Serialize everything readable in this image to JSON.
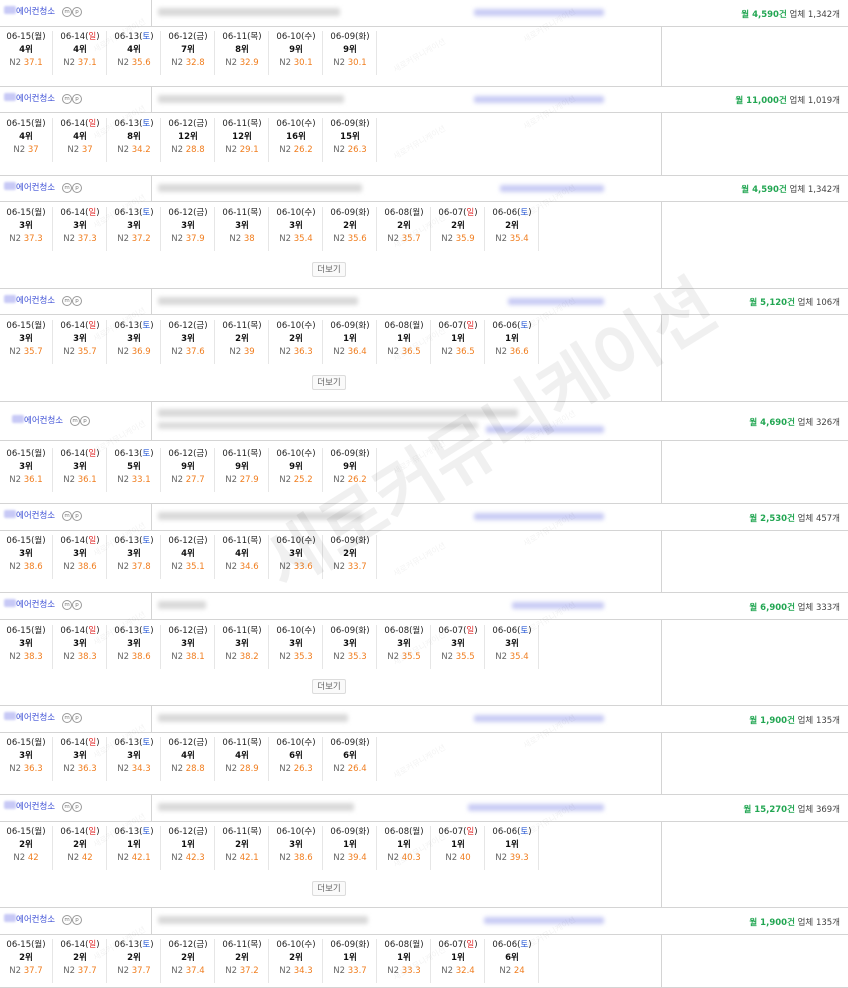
{
  "watermark": "새로커뮤니케이션",
  "more_label": "더보기",
  "monthly_unit": "건",
  "biz_unit": "개",
  "rows": [
    {
      "keyword": "에어컨청소",
      "monthly": "월 4,590건",
      "biz": "업체 1,342개",
      "more": false,
      "dates": [
        {
          "d": "06-15",
          "w": "월"
        },
        {
          "d": "06-14",
          "w": "일"
        },
        {
          "d": "06-13",
          "w": "토"
        },
        {
          "d": "06-12",
          "w": "금"
        },
        {
          "d": "06-11",
          "w": "목"
        },
        {
          "d": "06-10",
          "w": "수"
        },
        {
          "d": "06-09",
          "w": "화"
        }
      ],
      "ranks": [
        "4위",
        "4위",
        "4위",
        "7위",
        "8위",
        "9위",
        "9위"
      ],
      "n2": [
        "37.1",
        "37.1",
        "35.6",
        "32.8",
        "32.9",
        "30.1",
        "30.1"
      ]
    },
    {
      "keyword": "에어컨청소",
      "monthly": "월 11,000건",
      "biz": "업체 1,019개",
      "more": false,
      "dates": [
        {
          "d": "06-15",
          "w": "월"
        },
        {
          "d": "06-14",
          "w": "일"
        },
        {
          "d": "06-13",
          "w": "토"
        },
        {
          "d": "06-12",
          "w": "금"
        },
        {
          "d": "06-11",
          "w": "목"
        },
        {
          "d": "06-10",
          "w": "수"
        },
        {
          "d": "06-09",
          "w": "화"
        }
      ],
      "ranks": [
        "4위",
        "4위",
        "8위",
        "12위",
        "12위",
        "16위",
        "15위"
      ],
      "n2": [
        "37",
        "37",
        "34.2",
        "28.8",
        "29.1",
        "26.2",
        "26.3"
      ]
    },
    {
      "keyword": "에어컨청소",
      "monthly": "월 4,590건",
      "biz": "업체 1,342개",
      "more": true,
      "dates": [
        {
          "d": "06-15",
          "w": "월"
        },
        {
          "d": "06-14",
          "w": "일"
        },
        {
          "d": "06-13",
          "w": "토"
        },
        {
          "d": "06-12",
          "w": "금"
        },
        {
          "d": "06-11",
          "w": "목"
        },
        {
          "d": "06-10",
          "w": "수"
        },
        {
          "d": "06-09",
          "w": "화"
        },
        {
          "d": "06-08",
          "w": "월"
        },
        {
          "d": "06-07",
          "w": "일"
        },
        {
          "d": "06-06",
          "w": "토"
        }
      ],
      "ranks": [
        "3위",
        "3위",
        "3위",
        "3위",
        "3위",
        "3위",
        "2위",
        "2위",
        "2위",
        "2위"
      ],
      "n2": [
        "37.3",
        "37.3",
        "37.2",
        "37.9",
        "38",
        "35.4",
        "35.6",
        "35.7",
        "35.9",
        "35.4"
      ]
    },
    {
      "keyword": "에어컨청소",
      "monthly": "월 5,120건",
      "biz": "업체 106개",
      "more": true,
      "dates": [
        {
          "d": "06-15",
          "w": "월"
        },
        {
          "d": "06-14",
          "w": "일"
        },
        {
          "d": "06-13",
          "w": "토"
        },
        {
          "d": "06-12",
          "w": "금"
        },
        {
          "d": "06-11",
          "w": "목"
        },
        {
          "d": "06-10",
          "w": "수"
        },
        {
          "d": "06-09",
          "w": "화"
        },
        {
          "d": "06-08",
          "w": "월"
        },
        {
          "d": "06-07",
          "w": "일"
        },
        {
          "d": "06-06",
          "w": "토"
        }
      ],
      "ranks": [
        "3위",
        "3위",
        "3위",
        "3위",
        "2위",
        "2위",
        "1위",
        "1위",
        "1위",
        "1위"
      ],
      "n2": [
        "35.7",
        "35.7",
        "36.9",
        "37.6",
        "39",
        "36.3",
        "36.4",
        "36.5",
        "36.5",
        "36.6"
      ]
    },
    {
      "keyword": "에어컨청소",
      "monthly": "월 4,690건",
      "biz": "업체 326개",
      "more": false,
      "dates": [
        {
          "d": "06-15",
          "w": "월"
        },
        {
          "d": "06-14",
          "w": "일"
        },
        {
          "d": "06-13",
          "w": "토"
        },
        {
          "d": "06-12",
          "w": "금"
        },
        {
          "d": "06-11",
          "w": "목"
        },
        {
          "d": "06-10",
          "w": "수"
        },
        {
          "d": "06-09",
          "w": "화"
        }
      ],
      "ranks": [
        "3위",
        "3위",
        "5위",
        "9위",
        "9위",
        "9위",
        "9위"
      ],
      "n2": [
        "36.1",
        "36.1",
        "33.1",
        "27.7",
        "27.9",
        "25.2",
        "26.2"
      ]
    },
    {
      "keyword": "에어컨청소",
      "monthly": "월 2,530건",
      "biz": "업체 457개",
      "more": false,
      "dates": [
        {
          "d": "06-15",
          "w": "월"
        },
        {
          "d": "06-14",
          "w": "일"
        },
        {
          "d": "06-13",
          "w": "토"
        },
        {
          "d": "06-12",
          "w": "금"
        },
        {
          "d": "06-11",
          "w": "목"
        },
        {
          "d": "06-10",
          "w": "수"
        },
        {
          "d": "06-09",
          "w": "화"
        }
      ],
      "ranks": [
        "3위",
        "3위",
        "3위",
        "4위",
        "4위",
        "3위",
        "2위"
      ],
      "n2": [
        "38.6",
        "38.6",
        "37.8",
        "35.1",
        "34.6",
        "33.6",
        "33.7"
      ]
    },
    {
      "keyword": "에어컨청소",
      "monthly": "월 6,900건",
      "biz": "업체 333개",
      "more": true,
      "dates": [
        {
          "d": "06-15",
          "w": "월"
        },
        {
          "d": "06-14",
          "w": "일"
        },
        {
          "d": "06-13",
          "w": "토"
        },
        {
          "d": "06-12",
          "w": "금"
        },
        {
          "d": "06-11",
          "w": "목"
        },
        {
          "d": "06-10",
          "w": "수"
        },
        {
          "d": "06-09",
          "w": "화"
        },
        {
          "d": "06-08",
          "w": "월"
        },
        {
          "d": "06-07",
          "w": "일"
        },
        {
          "d": "06-06",
          "w": "토"
        }
      ],
      "ranks": [
        "3위",
        "3위",
        "3위",
        "3위",
        "3위",
        "3위",
        "3위",
        "3위",
        "3위",
        "3위"
      ],
      "n2": [
        "38.3",
        "38.3",
        "38.6",
        "38.1",
        "38.2",
        "35.3",
        "35.3",
        "35.5",
        "35.5",
        "35.4"
      ]
    },
    {
      "keyword": "에어컨청소",
      "monthly": "월 1,900건",
      "biz": "업체 135개",
      "more": false,
      "dates": [
        {
          "d": "06-15",
          "w": "월"
        },
        {
          "d": "06-14",
          "w": "일"
        },
        {
          "d": "06-13",
          "w": "토"
        },
        {
          "d": "06-12",
          "w": "금"
        },
        {
          "d": "06-11",
          "w": "목"
        },
        {
          "d": "06-10",
          "w": "수"
        },
        {
          "d": "06-09",
          "w": "화"
        }
      ],
      "ranks": [
        "3위",
        "3위",
        "3위",
        "4위",
        "4위",
        "6위",
        "6위"
      ],
      "n2": [
        "36.3",
        "36.3",
        "34.3",
        "28.8",
        "28.9",
        "26.3",
        "26.4"
      ]
    },
    {
      "keyword": "에어컨청소",
      "monthly": "월 15,270건",
      "biz": "업체 369개",
      "more": true,
      "dates": [
        {
          "d": "06-15",
          "w": "월"
        },
        {
          "d": "06-14",
          "w": "일"
        },
        {
          "d": "06-13",
          "w": "토"
        },
        {
          "d": "06-12",
          "w": "금"
        },
        {
          "d": "06-11",
          "w": "목"
        },
        {
          "d": "06-10",
          "w": "수"
        },
        {
          "d": "06-09",
          "w": "화"
        },
        {
          "d": "06-08",
          "w": "월"
        },
        {
          "d": "06-07",
          "w": "일"
        },
        {
          "d": "06-06",
          "w": "토"
        }
      ],
      "ranks": [
        "2위",
        "2위",
        "1위",
        "1위",
        "2위",
        "3위",
        "1위",
        "1위",
        "1위",
        "1위"
      ],
      "n2": [
        "42",
        "42",
        "42.1",
        "42.3",
        "42.1",
        "38.6",
        "39.4",
        "40.3",
        "40",
        "39.3"
      ]
    },
    {
      "keyword": "에어컨청소",
      "monthly": "월 1,900건",
      "biz": "업체 135개",
      "more": false,
      "dates": [
        {
          "d": "06-15",
          "w": "월"
        },
        {
          "d": "06-14",
          "w": "일"
        },
        {
          "d": "06-13",
          "w": "토"
        },
        {
          "d": "06-12",
          "w": "금"
        },
        {
          "d": "06-11",
          "w": "목"
        },
        {
          "d": "06-10",
          "w": "수"
        },
        {
          "d": "06-09",
          "w": "화"
        },
        {
          "d": "06-08",
          "w": "월"
        },
        {
          "d": "06-07",
          "w": "일"
        },
        {
          "d": "06-06",
          "w": "토"
        }
      ],
      "ranks": [
        "2위",
        "2위",
        "2위",
        "2위",
        "2위",
        "2위",
        "1위",
        "1위",
        "1위",
        "6위"
      ],
      "n2": [
        "37.7",
        "37.7",
        "37.7",
        "37.4",
        "37.2",
        "34.3",
        "33.7",
        "33.3",
        "32.4",
        "24"
      ]
    }
  ]
}
